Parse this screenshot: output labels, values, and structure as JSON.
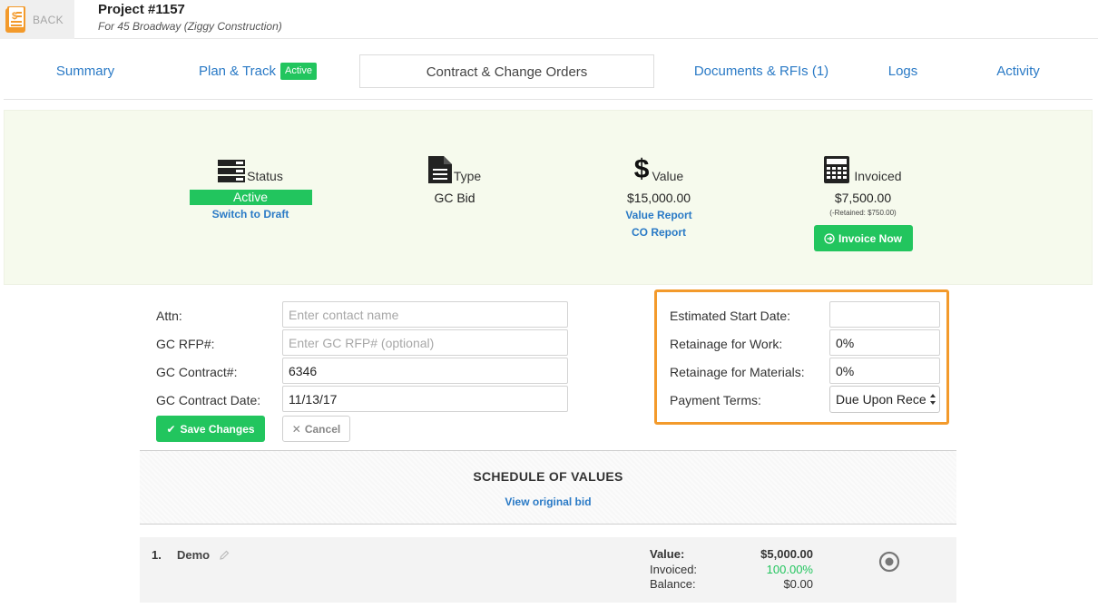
{
  "header": {
    "back_label": "BACK",
    "project_title": "Project #1157",
    "project_subtitle": "For 45 Broadway (Ziggy Construction)"
  },
  "tabs": [
    {
      "label": "Summary"
    },
    {
      "label": "Plan & Track",
      "badge": "Active"
    },
    {
      "label": "Contract & Change Orders"
    },
    {
      "label": "Documents & RFIs (1)"
    },
    {
      "label": "Logs"
    },
    {
      "label": "Activity"
    }
  ],
  "summary": {
    "status": {
      "label": "Status",
      "value": "Active",
      "link": "Switch to Draft"
    },
    "type": {
      "label": "Type",
      "value": "GC Bid"
    },
    "value": {
      "label": "Value",
      "amount": "$15,000.00",
      "link1": "Value Report",
      "link2": "CO Report"
    },
    "invoiced": {
      "label": "Invoiced",
      "amount": "$7,500.00",
      "retained_note": "(-Retained: $750.00)",
      "button": "Invoice Now"
    },
    "colors": {
      "accent_green": "#22c55e",
      "link_blue": "#2a7ac6",
      "panel_bg": "#f6faed"
    }
  },
  "form": {
    "attn_label": "Attn:",
    "attn_value": "",
    "attn_placeholder": "Enter contact name",
    "rfp_label": "GC RFP#:",
    "rfp_value": "",
    "rfp_placeholder": "Enter GC RFP# (optional)",
    "contract_label": "GC Contract#:",
    "contract_value": "6346",
    "date_label": "GC Contract Date:",
    "date_value": "11/13/17",
    "save_label": "Save Changes",
    "cancel_label": "Cancel"
  },
  "terms": {
    "start_label": "Estimated Start Date:",
    "start_value": "",
    "ret_work_label": "Retainage for Work:",
    "ret_work_value": "0%",
    "ret_mat_label": "Retainage for Materials:",
    "ret_mat_value": "0%",
    "payment_label": "Payment Terms:",
    "payment_value": "Due Upon Rece",
    "highlight_color": "#f39a2b"
  },
  "schedule": {
    "title": "SCHEDULE OF VALUES",
    "link": "View original bid",
    "items": [
      {
        "number": "1.",
        "name": "Demo",
        "value_label": "Value:",
        "value": "$5,000.00",
        "invoiced_label": "Invoiced:",
        "invoiced": "100.00%",
        "balance_label": "Balance:",
        "balance": "$0.00"
      }
    ]
  }
}
